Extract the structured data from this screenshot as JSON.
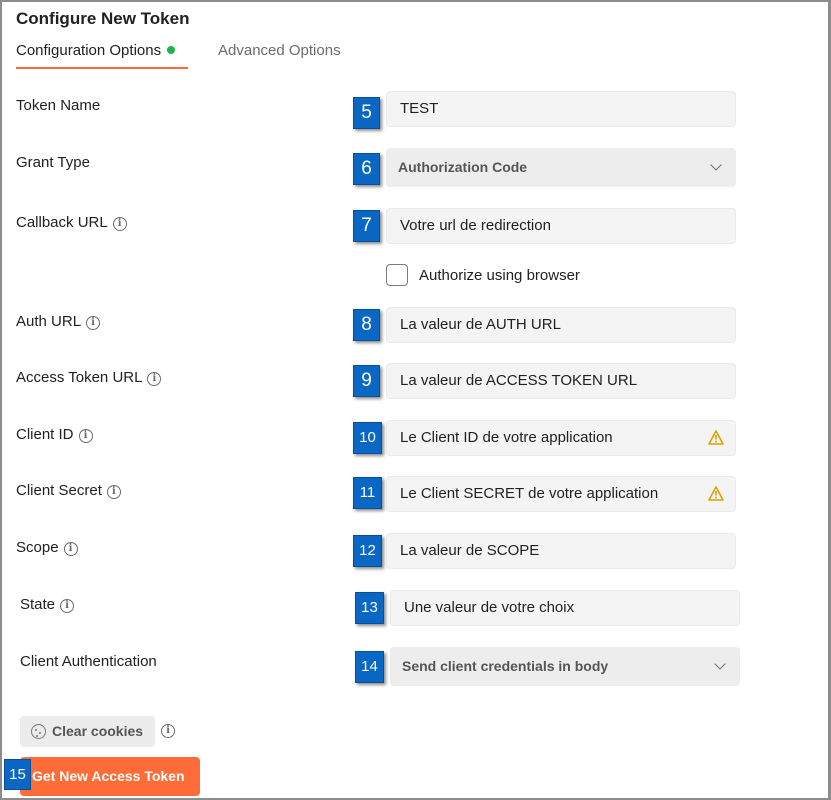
{
  "header": {
    "title": "Configure New Token",
    "tabs": [
      {
        "label": "Configuration Options",
        "active": true,
        "status_color": "#1fb14c"
      },
      {
        "label": "Advanced Options",
        "active": false
      }
    ],
    "accent_color": "#ff6c37"
  },
  "form": {
    "token_name": {
      "label": "Token Name",
      "value": "TEST",
      "badge": "5"
    },
    "grant_type": {
      "label": "Grant Type",
      "value": "Authorization Code",
      "badge": "6"
    },
    "callback_url": {
      "label": "Callback URL",
      "value": "Votre url de redirection",
      "badge": "7"
    },
    "authorize_browser": {
      "label": "Authorize using browser",
      "checked": false
    },
    "auth_url": {
      "label": "Auth URL",
      "value": "La valeur de AUTH URL",
      "badge": "8"
    },
    "access_token_url": {
      "label": "Access Token URL",
      "value": "La valeur de ACCESS TOKEN URL",
      "badge": "9"
    },
    "client_id": {
      "label": "Client ID",
      "value": "Le Client ID de votre application",
      "badge": "10",
      "icon": "warning-icon"
    },
    "client_secret": {
      "label": "Client Secret",
      "value": "Le Client SECRET de votre application",
      "badge": "11",
      "icon": "warning-icon"
    },
    "scope": {
      "label": "Scope",
      "value": "La valeur de SCOPE",
      "badge": "12"
    },
    "state": {
      "label": "State",
      "value": "Une valeur de votre choix",
      "badge": "13"
    },
    "client_authentication": {
      "label": "Client Authentication",
      "value": "Send client credentials in body",
      "badge": "14"
    }
  },
  "footer": {
    "clear_cookies_label": "Clear cookies",
    "get_token_label": "Get New Access Token",
    "get_token_badge": "15"
  },
  "colors": {
    "badge": "#0a68c4",
    "warning": "#e0a800",
    "primary_button": "#ff6c37"
  }
}
